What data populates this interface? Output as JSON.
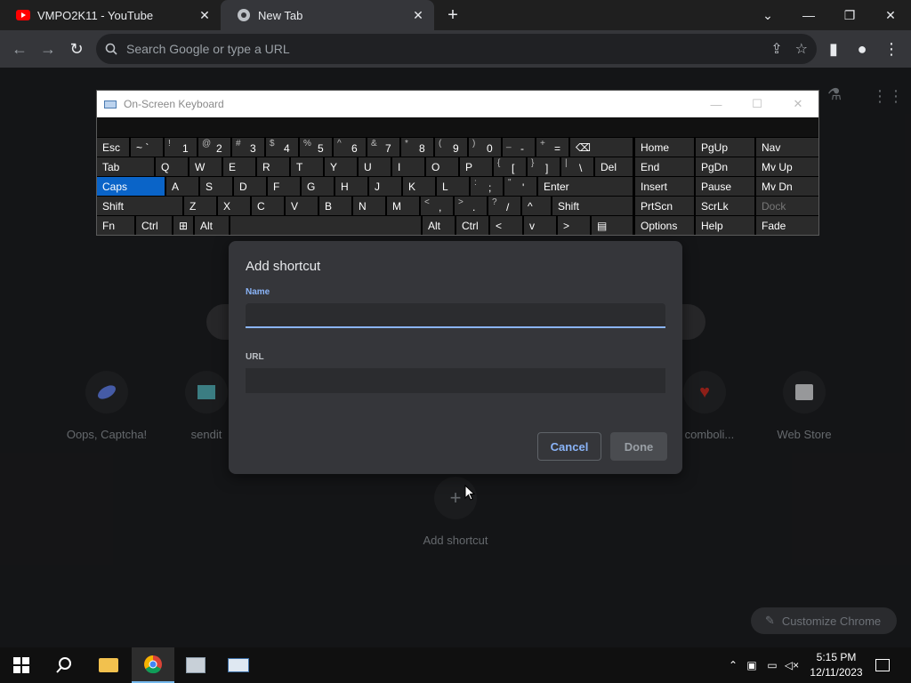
{
  "browser": {
    "tabs": [
      {
        "title": "VMPO2K11 - YouTube",
        "active": false
      },
      {
        "title": "New Tab",
        "active": true
      }
    ],
    "omnibox_placeholder": "Search Google or type a URL"
  },
  "ntp": {
    "shortcuts": [
      {
        "label": "Oops, Captcha!"
      },
      {
        "label": "sendit"
      },
      {
        "label": "e comboli..."
      },
      {
        "label": "Web Store"
      }
    ],
    "add_shortcut_label": "Add shortcut",
    "customize_label": "Customize Chrome"
  },
  "dialog": {
    "title": "Add shortcut",
    "name_label": "Name",
    "name_value": "",
    "url_label": "URL",
    "url_value": "",
    "cancel_label": "Cancel",
    "done_label": "Done"
  },
  "osk": {
    "title": "On-Screen Keyboard",
    "rows": [
      [
        [
          "Esc",
          ""
        ],
        [
          "~ `",
          ""
        ],
        [
          "!",
          "1"
        ],
        [
          "@",
          "2"
        ],
        [
          "#",
          "3"
        ],
        [
          "$",
          "4"
        ],
        [
          "%",
          "5"
        ],
        [
          "^",
          "6"
        ],
        [
          "&",
          "7"
        ],
        [
          "*",
          "8"
        ],
        [
          "(",
          "9"
        ],
        [
          ")",
          "0"
        ],
        [
          "_",
          "-"
        ],
        [
          "+",
          "="
        ],
        [
          "⌫",
          ""
        ]
      ],
      [
        [
          "Tab",
          ""
        ],
        [
          "Q",
          ""
        ],
        [
          "W",
          ""
        ],
        [
          "E",
          ""
        ],
        [
          "R",
          ""
        ],
        [
          "T",
          ""
        ],
        [
          "Y",
          ""
        ],
        [
          "U",
          ""
        ],
        [
          "I",
          ""
        ],
        [
          "O",
          ""
        ],
        [
          "P",
          ""
        ],
        [
          "{",
          "["
        ],
        [
          "}",
          "]"
        ],
        [
          "|",
          "\\"
        ],
        [
          "Del",
          ""
        ]
      ],
      [
        [
          "Caps",
          ""
        ],
        [
          "A",
          ""
        ],
        [
          "S",
          ""
        ],
        [
          "D",
          ""
        ],
        [
          "F",
          ""
        ],
        [
          "G",
          ""
        ],
        [
          "H",
          ""
        ],
        [
          "J",
          ""
        ],
        [
          "K",
          ""
        ],
        [
          "L",
          ""
        ],
        [
          ":",
          ";"
        ],
        [
          "\"",
          "'"
        ],
        [
          "Enter",
          ""
        ]
      ],
      [
        [
          "Shift",
          ""
        ],
        [
          "Z",
          ""
        ],
        [
          "X",
          ""
        ],
        [
          "C",
          ""
        ],
        [
          "V",
          ""
        ],
        [
          "B",
          ""
        ],
        [
          "N",
          ""
        ],
        [
          "M",
          ""
        ],
        [
          "<",
          ","
        ],
        [
          ">",
          "."
        ],
        [
          "?",
          "/"
        ],
        [
          "^",
          ""
        ],
        [
          "Shift",
          ""
        ]
      ],
      [
        [
          "Fn",
          ""
        ],
        [
          "Ctrl",
          ""
        ],
        [
          "⊞",
          ""
        ],
        [
          "Alt",
          ""
        ],
        [
          "",
          ""
        ],
        [
          "Alt",
          ""
        ],
        [
          "Ctrl",
          ""
        ],
        [
          "<",
          ""
        ],
        [
          "v",
          ""
        ],
        [
          ">",
          ""
        ],
        [
          "▤",
          ""
        ]
      ]
    ],
    "nav": [
      [
        "Home",
        "PgUp",
        "Nav"
      ],
      [
        "End",
        "PgDn",
        "Mv Up"
      ],
      [
        "Insert",
        "Pause",
        "Mv Dn"
      ],
      [
        "PrtScn",
        "ScrLk",
        "Dock"
      ],
      [
        "Options",
        "Help",
        "Fade"
      ]
    ]
  },
  "taskbar": {
    "time": "5:15 PM",
    "date": "12/11/2023"
  }
}
